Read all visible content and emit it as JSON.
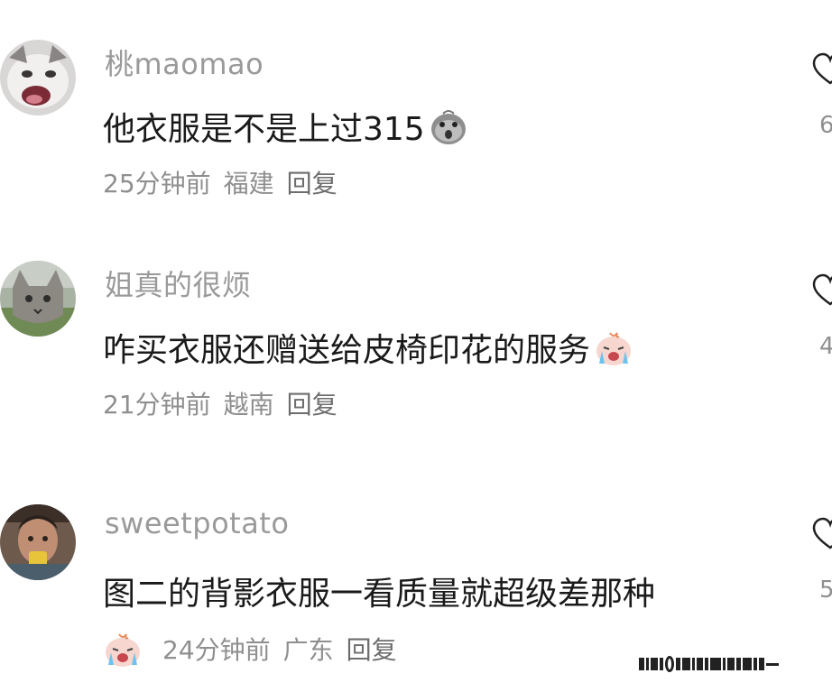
{
  "comments": [
    {
      "username": "桃maomao",
      "text": "他衣服是不是上过315",
      "emoji": "shocked-face-emoji",
      "time": "25分钟前",
      "location": "福建",
      "reply": "回复",
      "like_count": "6"
    },
    {
      "username": "姐真的很烦",
      "text": "咋买衣服还赠送给皮椅印花的服务",
      "emoji": "crying-face-emoji",
      "time": "21分钟前",
      "location": "越南",
      "reply": "回复",
      "like_count": "4"
    },
    {
      "username": "sweetpotato",
      "text": "图二的背影衣服一看质量就超级差那种",
      "emoji": "crying-face-emoji",
      "time": "24分钟前",
      "location": "广东",
      "reply": "回复",
      "like_count": "5"
    }
  ],
  "icons": {
    "like": "heart-outline-icon"
  },
  "colors": {
    "username": "#9a9a9a",
    "text": "#1a1a1a",
    "meta": "#8f8f8f"
  }
}
